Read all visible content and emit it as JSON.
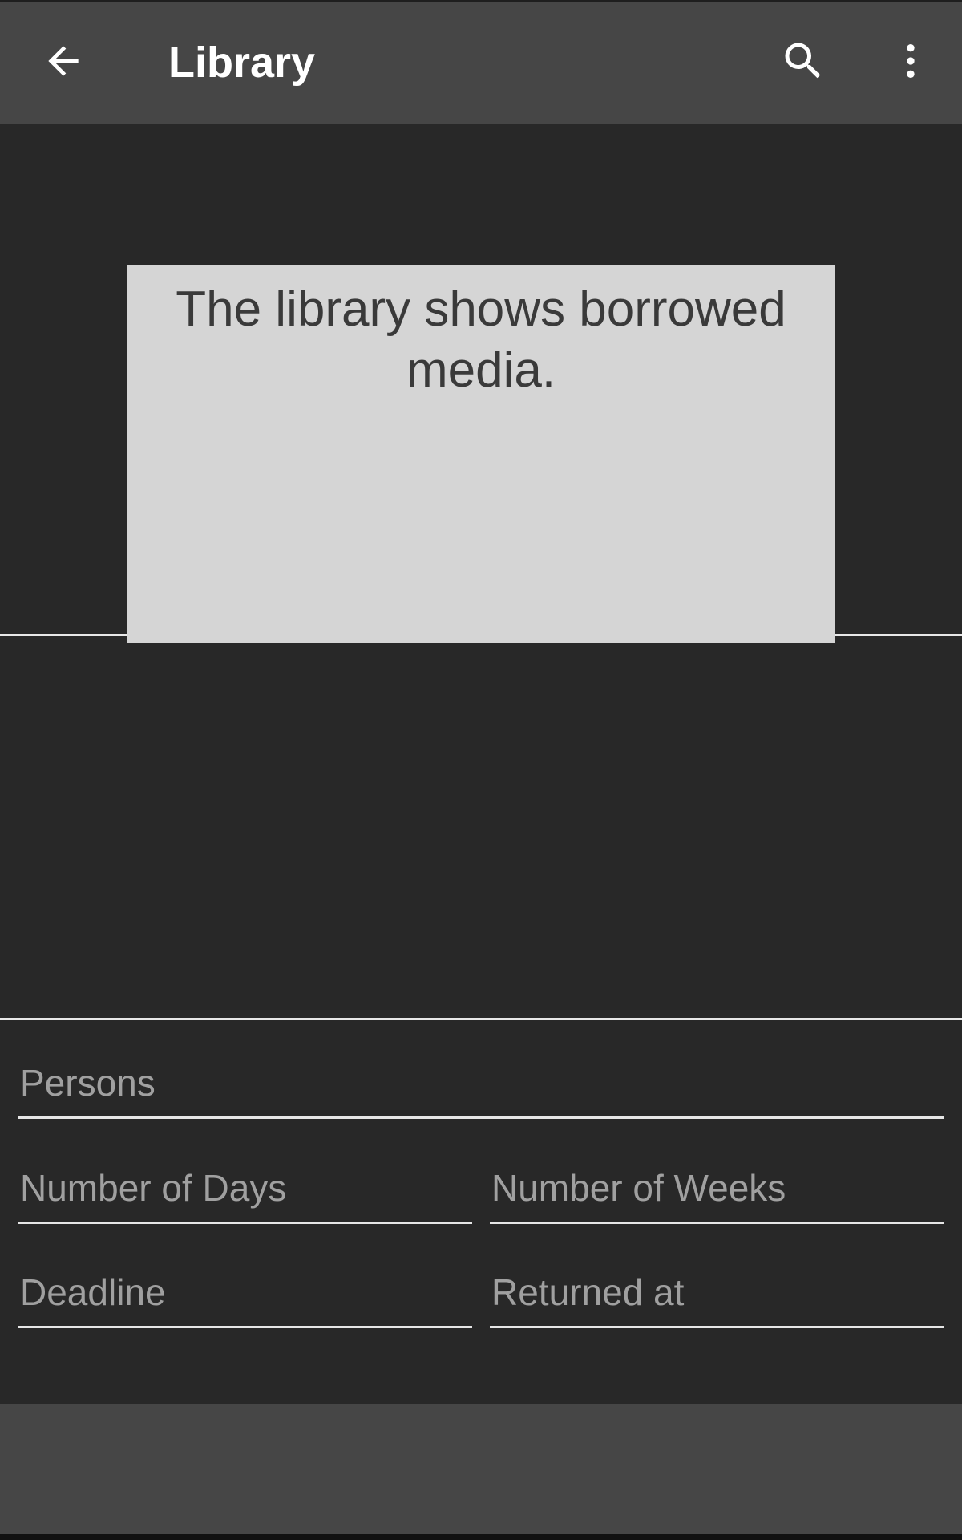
{
  "app_bar": {
    "title": "Library",
    "back_icon": "arrow-back-icon",
    "search_icon": "search-icon",
    "menu_icon": "more-vert-icon"
  },
  "info_card": {
    "text": "The library shows borrowed media."
  },
  "form": {
    "persons": {
      "placeholder": "Persons",
      "value": ""
    },
    "number_of_days": {
      "placeholder": "Number of Days",
      "value": ""
    },
    "number_of_weeks": {
      "placeholder": "Number of Weeks",
      "value": ""
    },
    "deadline": {
      "placeholder": "Deadline",
      "value": ""
    },
    "returned_at": {
      "placeholder": "Returned at",
      "value": ""
    }
  },
  "colors": {
    "app_bar": "#464646",
    "background": "#282828",
    "card": "#d5d5d5",
    "card_text": "#3a3a3a",
    "placeholder": "#a0a0a0"
  }
}
